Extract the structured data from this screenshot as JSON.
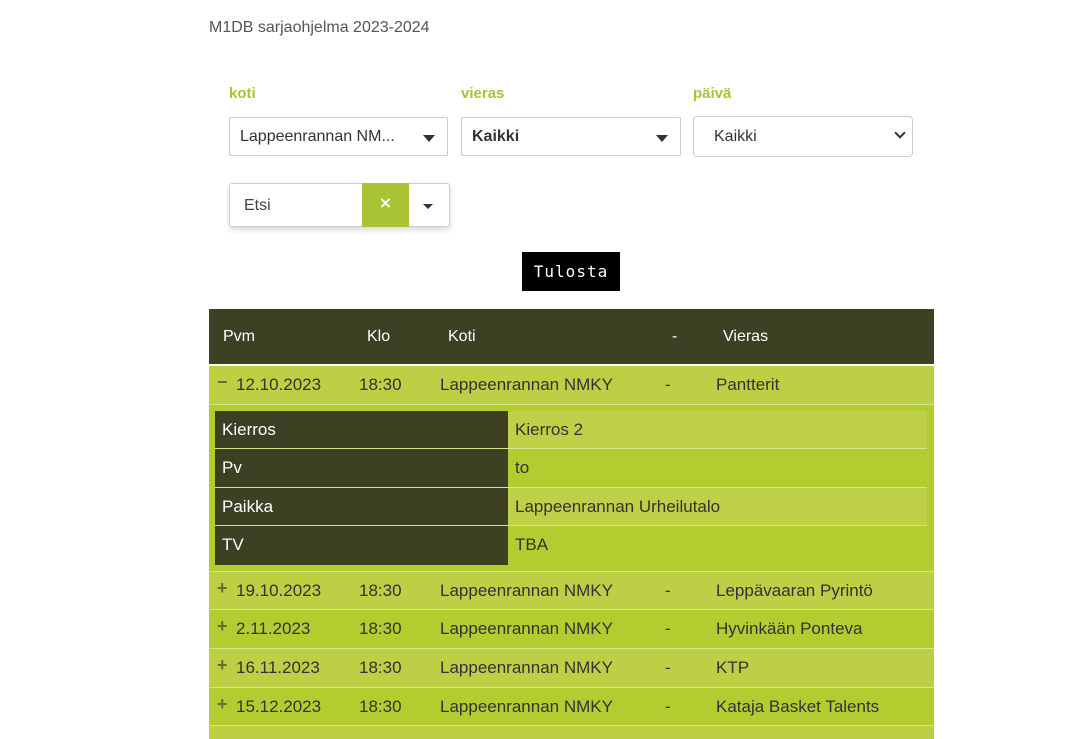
{
  "page": {
    "title": "M1DB sarjaohjelma 2023-2024"
  },
  "filters": {
    "home_label": "koti",
    "home_value": "Lappeenrannan NM...",
    "away_label": "vieras",
    "away_value": "Kaikki",
    "day_label": "päivä",
    "day_value": "Kaikki",
    "search_placeholder": "Etsi",
    "clear_symbol": "×"
  },
  "print_button": "Tulosta",
  "table": {
    "headers": {
      "date": "Pvm",
      "time": "Klo",
      "home": "Koti",
      "sep": "-",
      "away": "Vieras"
    },
    "rows": [
      {
        "toggle": "−",
        "date": "12.10.2023",
        "time": "18:30",
        "home": "Lappeenrannan NMKY",
        "sep": "-",
        "away": "Pantterit"
      },
      {
        "toggle": "+",
        "date": "19.10.2023",
        "time": "18:30",
        "home": "Lappeenrannan NMKY",
        "sep": "-",
        "away": "Leppävaaran Pyrintö"
      },
      {
        "toggle": "+",
        "date": "2.11.2023",
        "time": "18:30",
        "home": "Lappeenrannan NMKY",
        "sep": "-",
        "away": "Hyvinkään Ponteva"
      },
      {
        "toggle": "+",
        "date": "16.11.2023",
        "time": "18:30",
        "home": "Lappeenrannan NMKY",
        "sep": "-",
        "away": "KTP"
      },
      {
        "toggle": "+",
        "date": "15.12.2023",
        "time": "18:30",
        "home": "Lappeenrannan NMKY",
        "sep": "-",
        "away": "Kataja Basket Talents"
      }
    ],
    "details": [
      {
        "key": "Kierros",
        "value": "Kierros 2"
      },
      {
        "key": "Pv",
        "value": "to"
      },
      {
        "key": "Paikka",
        "value": "Lappeenrannan Urheilutalo"
      },
      {
        "key": "TV",
        "value": "TBA"
      }
    ]
  },
  "colors": {
    "accent": "#a8c434",
    "header_bg": "#3e4024",
    "row_bg": "#b3cc2f"
  }
}
